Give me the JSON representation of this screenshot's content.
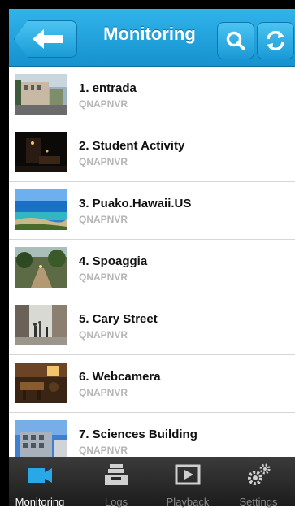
{
  "header": {
    "title": "Monitoring",
    "back_icon": "back-arrow-icon",
    "search_icon": "search-icon",
    "refresh_icon": "refresh-icon",
    "accent": "#1fa3e0"
  },
  "cameras": [
    {
      "title": "1. entrada",
      "server": "QNAPNVR",
      "thumb": "building-street"
    },
    {
      "title": "2. Student Activity",
      "server": "QNAPNVR",
      "thumb": "night-scene"
    },
    {
      "title": "3. Puako.Hawaii.US",
      "server": "QNAPNVR",
      "thumb": "beach-ocean"
    },
    {
      "title": "4. Spoaggia",
      "server": "QNAPNVR",
      "thumb": "garden-path"
    },
    {
      "title": "5. Cary Street",
      "server": "QNAPNVR",
      "thumb": "street-crowd"
    },
    {
      "title": "6. Webcamera",
      "server": "QNAPNVR",
      "thumb": "indoor-room"
    },
    {
      "title": "7. Sciences Building",
      "server": "QNAPNVR",
      "thumb": "building-sky"
    }
  ],
  "tabs": [
    {
      "label": "Monitoring",
      "icon": "camera-icon",
      "active": true
    },
    {
      "label": "Logs",
      "icon": "inbox-tray-icon",
      "active": false
    },
    {
      "label": "Playback",
      "icon": "play-icon",
      "active": false
    },
    {
      "label": "Settings",
      "icon": "gears-icon",
      "active": false
    }
  ]
}
